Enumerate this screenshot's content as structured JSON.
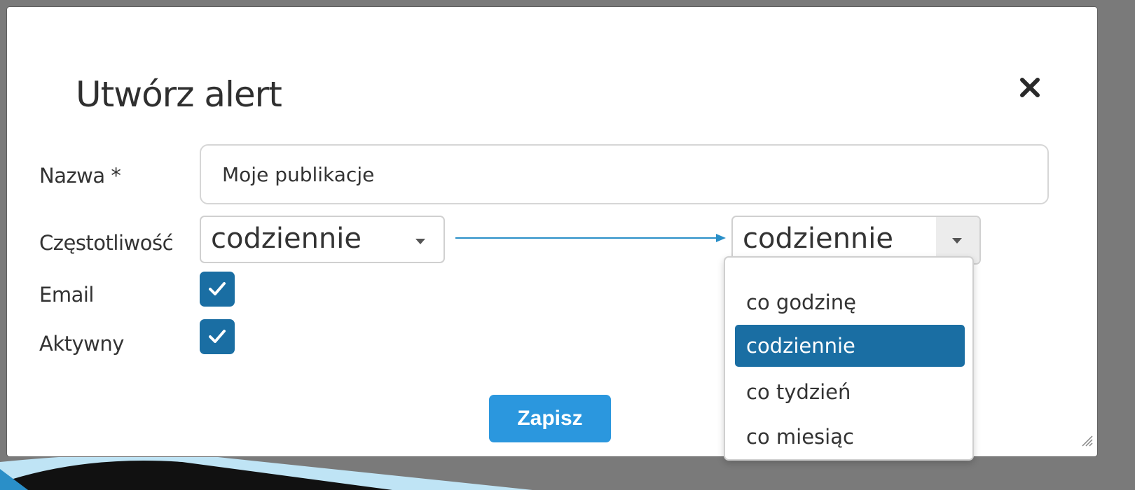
{
  "dialog": {
    "title": "Utwórz alert",
    "close_icon": "close-icon",
    "save_label": "Zapisz",
    "resize_icon": "resize-grip-icon"
  },
  "form": {
    "name_label": "Nazwa *",
    "name_value": "Moje publikacje",
    "frequency_label": "Częstotliwość",
    "frequency_value": "codziennie",
    "email_label": "Email",
    "email_checked": true,
    "active_label": "Aktywny",
    "active_checked": true
  },
  "frequency_dropdown": {
    "selected_value": "codziennie",
    "options": [
      {
        "label": "co godzinę",
        "selected": false
      },
      {
        "label": "codziennie",
        "selected": true
      },
      {
        "label": "co tydzień",
        "selected": false
      },
      {
        "label": "co miesiąc",
        "selected": false
      }
    ]
  },
  "colors": {
    "accent": "#1a6ea3",
    "button": "#2b97de",
    "arrow": "#2a8fc8"
  }
}
